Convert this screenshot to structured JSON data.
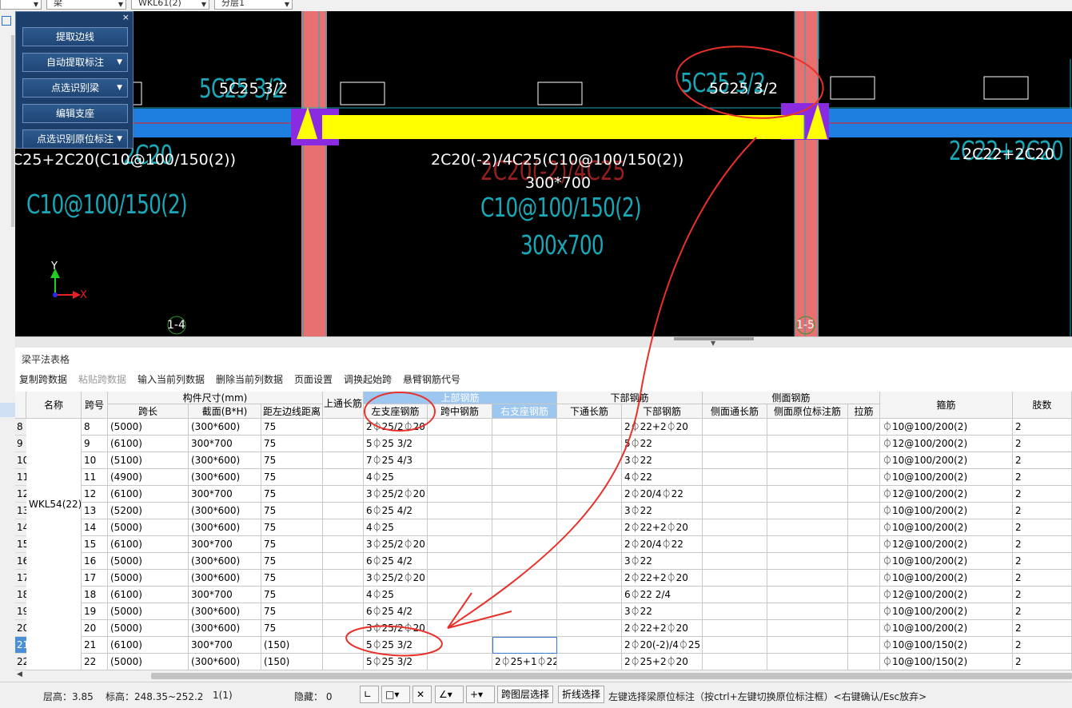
{
  "topbar": {
    "combos": [
      "梁",
      "WKL61(2)",
      "分层1"
    ]
  },
  "panel": {
    "close": "×",
    "buttons": [
      {
        "label": "提取边线",
        "dropdown": false
      },
      {
        "label": "自动提取标注",
        "dropdown": true
      },
      {
        "label": "点选识别梁",
        "dropdown": true
      },
      {
        "label": "编辑支座",
        "dropdown": false
      },
      {
        "label": "点选识别原位标注",
        "dropdown": true
      }
    ]
  },
  "cad": {
    "white_labels": [
      "5C25 3/2",
      "5C25 3/2",
      "C25+2C20(C10@100/150(2))",
      "2C20(-2)/4C25(C10@100/150(2))",
      "300*700",
      "2C22+2C20"
    ],
    "cyan_labels": [
      "5C25 3/2",
      "5C25 3/2",
      "C10@100/150(2)",
      "2C20",
      "C10@100/150(2)",
      "300x700",
      "2C22+2C20"
    ],
    "red_labels": [
      "2C20(-2)/4C25"
    ],
    "axis_labels": [
      "1-4",
      "1-5"
    ],
    "ucs": {
      "x": "X",
      "y": "Y"
    }
  },
  "table": {
    "title": "梁平法表格",
    "toolbar": [
      {
        "label": "复制跨数据",
        "enabled": true
      },
      {
        "label": "粘贴跨数据",
        "enabled": false
      },
      {
        "label": "输入当前列数据",
        "enabled": true
      },
      {
        "label": "删除当前列数据",
        "enabled": true
      },
      {
        "label": "页面设置",
        "enabled": true
      },
      {
        "label": "调换起始跨",
        "enabled": true
      },
      {
        "label": "悬臂钢筋代号",
        "enabled": true
      }
    ],
    "group_headers": {
      "size": "构件尺寸(mm)",
      "top": "上部钢筋",
      "bottom": "下部钢筋",
      "side": "侧面钢筋"
    },
    "headers": {
      "name": "名称",
      "span": "跨号",
      "length": "跨长",
      "section": "截面(B*H)",
      "offset": "距左边线距离",
      "top_through": "上通长筋",
      "left_support": "左支座钢筋",
      "mid": "跨中钢筋",
      "right_support": "右支座钢筋",
      "bottom_through": "下通长筋",
      "bottom_bar": "下部钢筋",
      "side_through": "侧面通长筋",
      "side_orig": "侧面原位标注筋",
      "tie": "拉筋",
      "stirrup": "箍筋",
      "legs": "肢数"
    },
    "beam_name": "WKL54(22)",
    "rows": [
      {
        "idx": "8",
        "span": "8",
        "length": "(5000)",
        "section": "(300*600)",
        "offset": "75",
        "left": "2⏀25/2⏀20",
        "right": "",
        "bottom": "2⏀22+2⏀20",
        "stirrup": "⏀10@100/200(2)",
        "legs": "2"
      },
      {
        "idx": "9",
        "span": "9",
        "length": "(6100)",
        "section": "300*700",
        "offset": "75",
        "left": "5⏀25 3/2",
        "right": "",
        "bottom": "5⏀22",
        "stirrup": "⏀12@100/200(2)",
        "legs": "2"
      },
      {
        "idx": "10",
        "span": "10",
        "length": "(5100)",
        "section": "(300*600)",
        "offset": "75",
        "left": "7⏀25 4/3",
        "right": "",
        "bottom": "3⏀22",
        "stirrup": "⏀10@100/200(2)",
        "legs": "2"
      },
      {
        "idx": "11",
        "span": "11",
        "length": "(4900)",
        "section": "(300*600)",
        "offset": "75",
        "left": "4⏀25",
        "right": "",
        "bottom": "4⏀22",
        "stirrup": "⏀10@100/200(2)",
        "legs": "2"
      },
      {
        "idx": "12",
        "span": "12",
        "length": "(6100)",
        "section": "300*700",
        "offset": "75",
        "left": "3⏀25/2⏀20",
        "right": "",
        "bottom": "2⏀20/4⏀22",
        "stirrup": "⏀12@100/200(2)",
        "legs": "2"
      },
      {
        "idx": "13",
        "span": "13",
        "length": "(5200)",
        "section": "(300*600)",
        "offset": "75",
        "left": "6⏀25 4/2",
        "right": "",
        "bottom": "3⏀22",
        "stirrup": "⏀10@100/200(2)",
        "legs": "2"
      },
      {
        "idx": "14",
        "span": "14",
        "length": "(5000)",
        "section": "(300*600)",
        "offset": "75",
        "left": "4⏀25",
        "right": "",
        "bottom": "2⏀22+2⏀20",
        "stirrup": "⏀10@100/200(2)",
        "legs": "2"
      },
      {
        "idx": "15",
        "span": "15",
        "length": "(6100)",
        "section": "300*700",
        "offset": "75",
        "left": "3⏀25/2⏀20",
        "right": "",
        "bottom": "2⏀20/4⏀22",
        "stirrup": "⏀12@100/200(2)",
        "legs": "2"
      },
      {
        "idx": "16",
        "span": "16",
        "length": "(5000)",
        "section": "(300*600)",
        "offset": "75",
        "left": "6⏀25 4/2",
        "right": "",
        "bottom": "3⏀22",
        "stirrup": "⏀10@100/200(2)",
        "legs": "2"
      },
      {
        "idx": "17",
        "span": "17",
        "length": "(5000)",
        "section": "(300*600)",
        "offset": "75",
        "left": "3⏀25/2⏀20",
        "right": "",
        "bottom": "2⏀22+2⏀20",
        "stirrup": "⏀10@100/200(2)",
        "legs": "2"
      },
      {
        "idx": "18",
        "span": "18",
        "length": "(6100)",
        "section": "300*700",
        "offset": "75",
        "left": "4⏀25",
        "right": "",
        "bottom": "6⏀22 2/4",
        "stirrup": "⏀12@100/200(2)",
        "legs": "2"
      },
      {
        "idx": "19",
        "span": "19",
        "length": "(5000)",
        "section": "(300*600)",
        "offset": "75",
        "left": "6⏀25 4/2",
        "right": "",
        "bottom": "3⏀22",
        "stirrup": "⏀10@100/200(2)",
        "legs": "2"
      },
      {
        "idx": "20",
        "span": "20",
        "length": "(5000)",
        "section": "(300*600)",
        "offset": "75",
        "left": "3⏀25/2⏀20",
        "right": "",
        "bottom": "2⏀22+2⏀20",
        "stirrup": "⏀10@100/200(2)",
        "legs": "2"
      },
      {
        "idx": "21",
        "span": "21",
        "length": "(6100)",
        "section": "300*700",
        "offset": "(150)",
        "left": "5⏀25 3/2",
        "right": "",
        "bottom": "2⏀20(-2)/4⏀25",
        "stirrup": "⏀10@100/150(2)",
        "legs": "2"
      },
      {
        "idx": "22",
        "span": "22",
        "length": "(5000)",
        "section": "(300*600)",
        "offset": "(150)",
        "left": "5⏀25 3/2",
        "right": "2⏀25+1⏀22",
        "bottom": "2⏀25+2⏀20",
        "stirrup": "⏀10@100/150(2)",
        "legs": "2"
      }
    ]
  },
  "status": {
    "floor_height": "层高：3.85",
    "elevation": "标高：248.35~252.2",
    "count": "1(1)",
    "hidden": "隐藏：  0",
    "btn_layer_select": "跨图层选择",
    "btn_polyline_select": "折线选择",
    "hint": "左键选择梁原位标注（按ctrl+左键切换原位标注框）<右键确认/Esc放弃>"
  },
  "colors": {
    "beam_yellow": "#ffff00",
    "beam_blue": "#1f7fe0",
    "column_red": "#e87070",
    "support_purple": "#8a2be2",
    "annotation_red": "#e8312a",
    "header_blue": "#9ec7f0"
  }
}
